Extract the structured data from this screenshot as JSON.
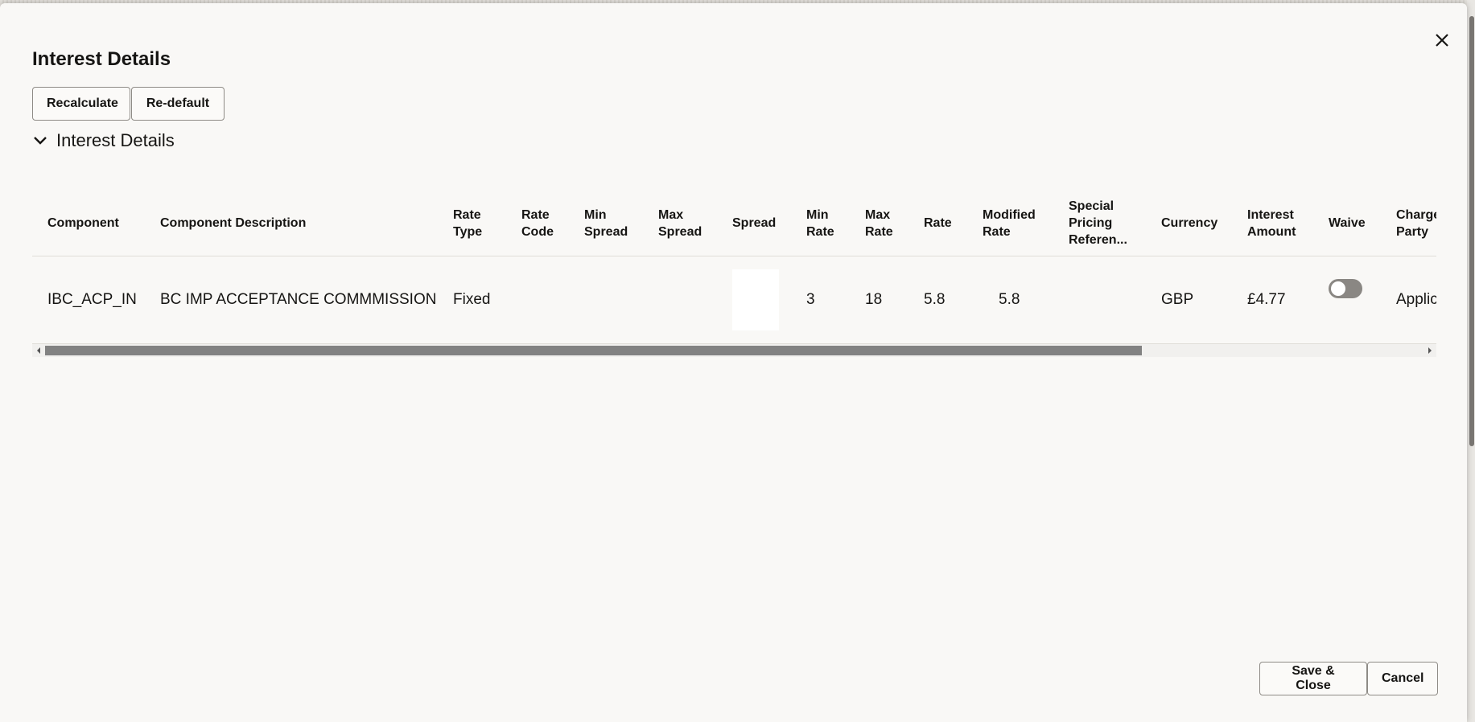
{
  "dialog": {
    "title": "Interest Details",
    "close_icon": "close-icon"
  },
  "toolbar": {
    "recalculate_label": "Recalculate",
    "redefault_label": "Re-default"
  },
  "section": {
    "title": "Interest Details",
    "expanded": true,
    "chevron_icon": "chevron-down-icon"
  },
  "table": {
    "columns": [
      "Component",
      "Component Description",
      "Rate\nType",
      "Rate\nCode",
      "Min\nSpread",
      "Max\nSpread",
      "Spread",
      "Min\nRate",
      "Max\nRate",
      "Rate",
      "Modified\nRate",
      "Special\nPricing\nReferen...",
      "Currency",
      "Interest\nAmount",
      "Waive",
      "Charge\nParty"
    ],
    "rows": [
      {
        "component": "IBC_ACP_IN",
        "description": "BC IMP ACCEPTANCE COMMMISSION",
        "rate_type": "Fixed",
        "rate_code": "",
        "min_spread": "",
        "max_spread": "",
        "spread": "",
        "min_rate": "3",
        "max_rate": "18",
        "rate": "5.8",
        "modified_rate": "5.8",
        "special_pricing_reference": "",
        "currency": "GBP",
        "interest_amount": "£4.77",
        "waive": false,
        "charge_party": "Applic"
      }
    ]
  },
  "footer": {
    "save_close_label": "Save & Close",
    "cancel_label": "Cancel"
  },
  "colors": {
    "dialog_background": "#f9f8f6",
    "text": "#161513",
    "toggle_off": "#8a8783",
    "scrollbar_thumb": "#828282"
  }
}
